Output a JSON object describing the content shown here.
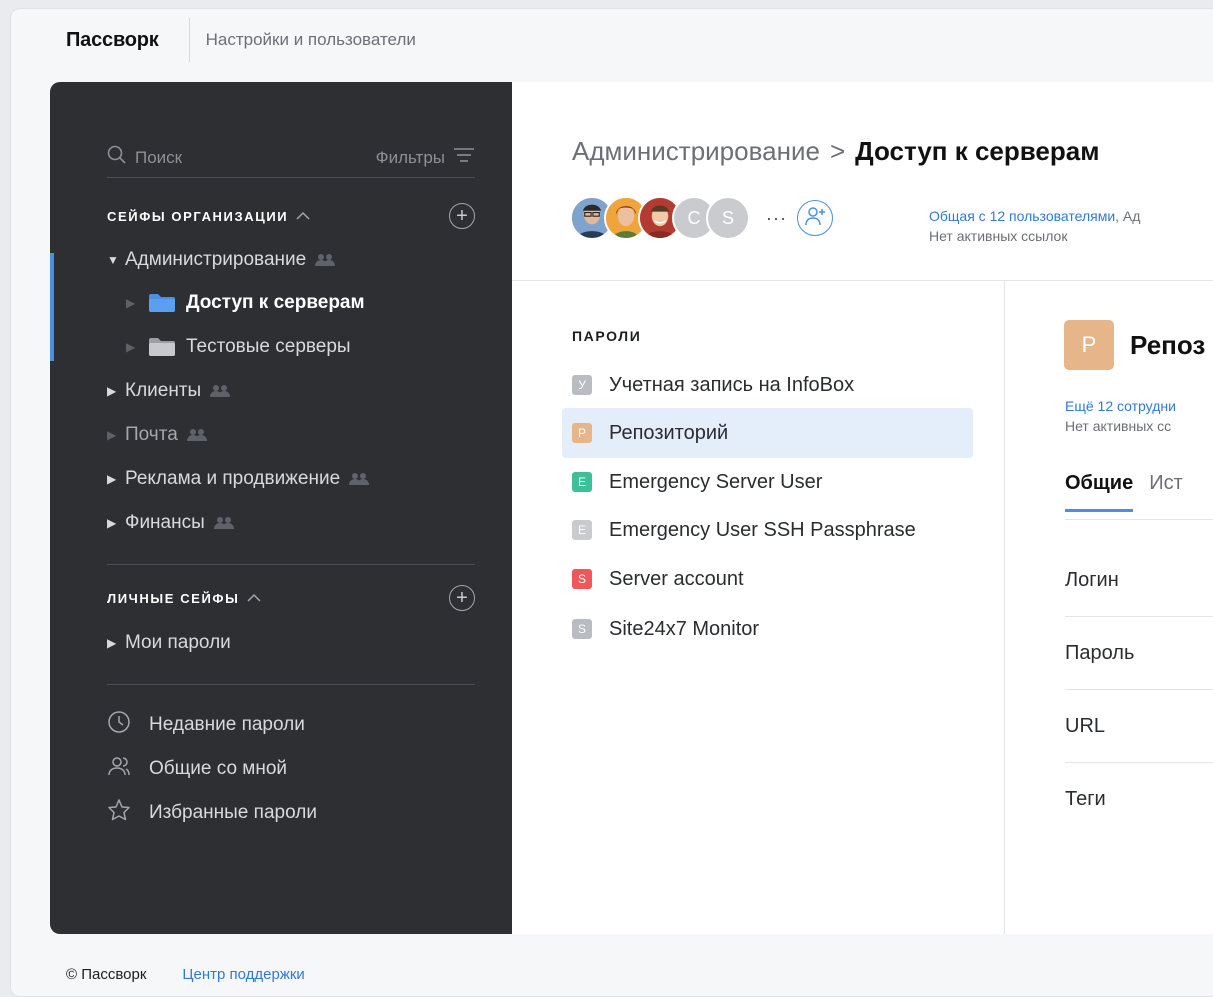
{
  "topbar": {
    "brand": "Пассворк",
    "subtitle": "Настройки и пользователи"
  },
  "sidebar": {
    "search_label": "Поиск",
    "filters_label": "Фильтры",
    "org_section": {
      "title": "СЕЙФЫ ОРГАНИЗАЦИИ"
    },
    "org_items": [
      {
        "label": "Администрирование"
      },
      {
        "label": "Доступ к серверам"
      },
      {
        "label": "Тестовые серверы"
      },
      {
        "label": "Клиенты"
      },
      {
        "label": "Почта"
      },
      {
        "label": "Реклама и продвижение"
      },
      {
        "label": "Финансы"
      }
    ],
    "personal_section": {
      "title": "ЛИЧНЫЕ СЕЙФЫ"
    },
    "personal_items": [
      {
        "label": "Мои пароли"
      }
    ],
    "nav": [
      {
        "label": "Недавние пароли",
        "icon": "clock-icon"
      },
      {
        "label": "Общие со мной",
        "icon": "users-icon"
      },
      {
        "label": "Избранные пароли",
        "icon": "star-icon"
      }
    ]
  },
  "content": {
    "breadcrumb_parent": "Администрирование",
    "breadcrumb_sep": ">",
    "breadcrumb_current": "Доступ к серверам",
    "avatars": [
      "",
      "",
      "",
      "C",
      "S"
    ],
    "more_label": "···",
    "share_link": "Общая с 12 пользователями",
    "share_rest": ", Ад",
    "no_links": "Нет активных ссылок",
    "passwords_title": "ПАРОЛИ",
    "passwords": [
      {
        "badge": "У",
        "label": "Учетная запись на InfoBox",
        "color": "#b9bcc1"
      },
      {
        "badge": "Р",
        "label": "Репозиторий",
        "color": "#e7b58a"
      },
      {
        "badge": "E",
        "label": "Emergency Server User",
        "color": "#3dbf97"
      },
      {
        "badge": "E",
        "label": "Emergency User SSH Passphrase",
        "color": "#c9cbcf"
      },
      {
        "badge": "S",
        "label": "Server account",
        "color": "#f0575a"
      },
      {
        "badge": "S",
        "label": "Site24x7 Monitor",
        "color": "#b9bcc1"
      }
    ],
    "detail": {
      "badge": "Р",
      "title": "Репоз",
      "share_link": "Ещё 12 сотрудни",
      "no_links": "Нет активных сс",
      "tabs": [
        "Общие",
        "Ист"
      ],
      "fields": [
        "Логин",
        "Пароль",
        "URL",
        "Теги"
      ]
    }
  },
  "footer": {
    "copyright": "© Пассворк",
    "support": "Центр поддержки"
  },
  "colors": {
    "sidebar_bg": "#2d2f33",
    "accent": "#4a8fe2",
    "link": "#2f7ad8"
  }
}
